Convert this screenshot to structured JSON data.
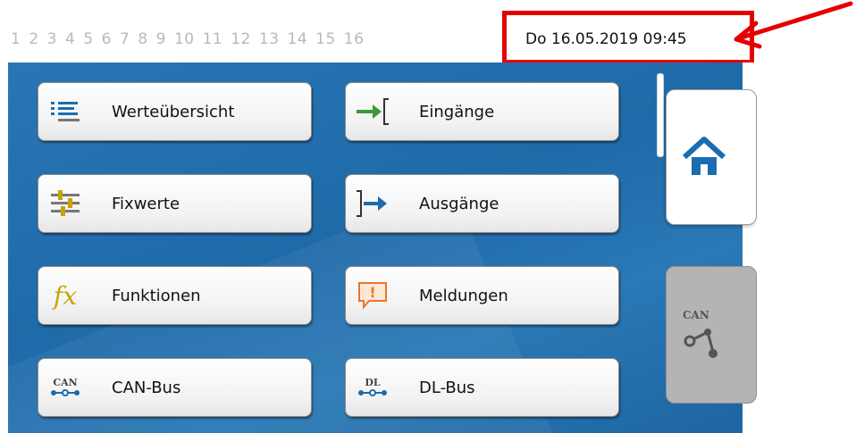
{
  "header": {
    "page_numbers": [
      "1",
      "2",
      "3",
      "4",
      "5",
      "6",
      "7",
      "8",
      "9",
      "10",
      "11",
      "12",
      "13",
      "14",
      "15",
      "16"
    ],
    "datetime": "Do 16.05.2019 09:45"
  },
  "menu": {
    "values_overview": "Werteübersicht",
    "inputs": "Eingänge",
    "fixed_values": "Fixwerte",
    "outputs": "Ausgänge",
    "functions": "Funktionen",
    "messages": "Meldungen",
    "can_bus": "CAN-Bus",
    "dl_bus": "DL-Bus"
  },
  "icons": {
    "fx_letters": "fx",
    "can_label": "CAN",
    "dl_label": "DL",
    "messages_mark": "!"
  },
  "side_tabs": {
    "can_label": "CAN"
  },
  "colors": {
    "panel_blue": "#1f6aa8",
    "highlight_red": "#e60000",
    "icon_blue": "#1a6db0",
    "icon_green": "#3a9a3a",
    "icon_gold": "#c9a400",
    "icon_orange": "#e8772a"
  }
}
